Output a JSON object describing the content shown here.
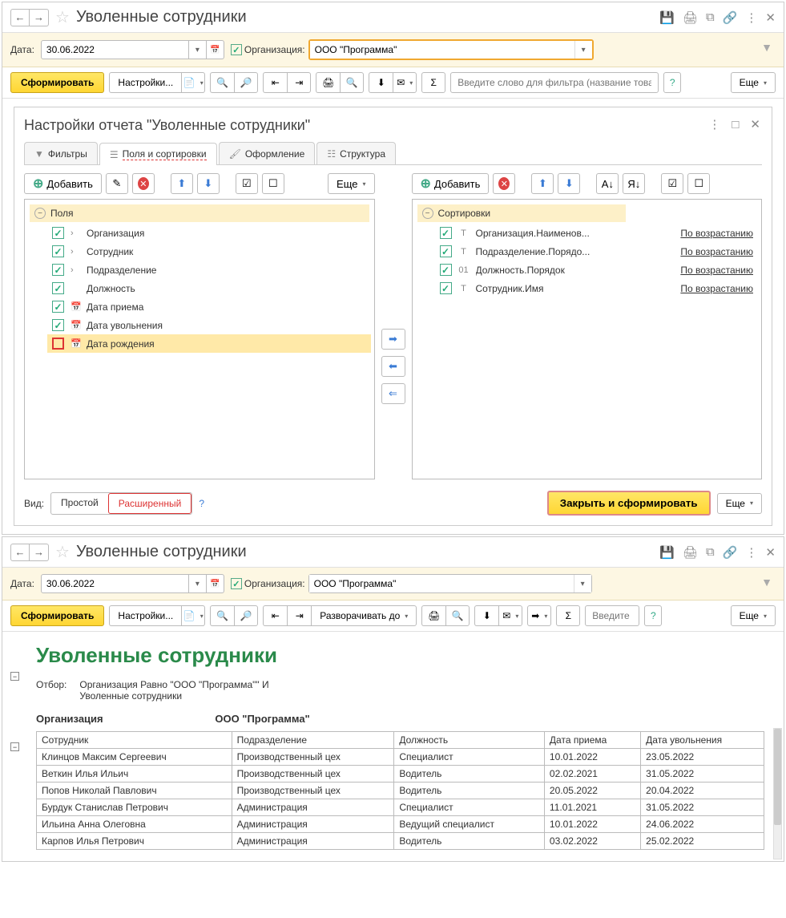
{
  "top": {
    "title": "Уволенные сотрудники",
    "date_label": "Дата:",
    "date_value": "30.06.2022",
    "org_label": "Организация:",
    "org_value": "ООО \"Программа\"",
    "form_btn": "Сформировать",
    "settings_btn": "Настройки...",
    "more_btn": "Еще",
    "search_placeholder": "Введите слово для фильтра (название товар..."
  },
  "settings": {
    "title": "Настройки отчета \"Уволенные сотрудники\"",
    "tab_filters": "Фильтры",
    "tab_fields": "Поля и сортировки",
    "tab_format": "Оформление",
    "tab_struct": "Структура",
    "add_btn": "Добавить",
    "more_btn": "Еще",
    "fields_header": "Поля",
    "sort_header": "Сортировки",
    "fields": [
      {
        "label": "Организация",
        "checked": true,
        "expand": true
      },
      {
        "label": "Сотрудник",
        "checked": true,
        "expand": true
      },
      {
        "label": "Подразделение",
        "checked": true,
        "expand": true
      },
      {
        "label": "Должность",
        "checked": true,
        "expand": false
      },
      {
        "label": "Дата приема",
        "checked": true,
        "expand": false,
        "icon": "date"
      },
      {
        "label": "Дата увольнения",
        "checked": true,
        "expand": false,
        "icon": "date"
      },
      {
        "label": "Дата рождения",
        "checked": false,
        "expand": false,
        "icon": "date",
        "selected": true
      }
    ],
    "sorts": [
      {
        "label": "Организация.Наименов...",
        "type": "T",
        "dir": "По возрастанию"
      },
      {
        "label": "Подразделение.Порядо...",
        "type": "T",
        "dir": "По возрастанию"
      },
      {
        "label": "Должность.Порядок",
        "type": "01",
        "dir": "По возрастанию"
      },
      {
        "label": "Сотрудник.Имя",
        "type": "T",
        "dir": "По возрастанию"
      }
    ],
    "view_label": "Вид:",
    "view_simple": "Простой",
    "view_ext": "Расширенный",
    "close_apply": "Закрыть и сформировать"
  },
  "bottom": {
    "title": "Уволенные сотрудники",
    "date_value": "30.06.2022",
    "org_value": "ООО \"Программа\"",
    "expand_btn": "Разворачивать до",
    "search_placeholder": "Введите сл...",
    "report_title": "Уволенные сотрудники",
    "filter_label": "Отбор:",
    "filter_text1": "Организация Равно \"ООО \"Программа\"\" И",
    "filter_text2": "Уволенные сотрудники",
    "org_header": "Организация",
    "org_value_bold": "ООО \"Программа\"",
    "cols": {
      "emp": "Сотрудник",
      "dept": "Подразделение",
      "pos": "Должность",
      "hire": "Дата приема",
      "fire": "Дата увольнения"
    },
    "rows": [
      {
        "emp": "Клинцов Максим Сергеевич",
        "dept": "Производственный цех",
        "pos": "Специалист",
        "hire": "10.01.2022",
        "fire": "23.05.2022"
      },
      {
        "emp": "Веткин Илья Ильич",
        "dept": "Производственный цех",
        "pos": "Водитель",
        "hire": "02.02.2021",
        "fire": "31.05.2022"
      },
      {
        "emp": "Попов Николай Павлович",
        "dept": "Производственный цех",
        "pos": "Водитель",
        "hire": "20.05.2022",
        "fire": "20.04.2022"
      },
      {
        "emp": "Бурдук Станислав Петрович",
        "dept": "Администрация",
        "pos": "Специалист",
        "hire": "11.01.2021",
        "fire": "31.05.2022"
      },
      {
        "emp": "Ильина Анна Олеговна",
        "dept": "Администрация",
        "pos": "Ведущий специалист",
        "hire": "10.01.2022",
        "fire": "24.06.2022"
      },
      {
        "emp": "Карпов Илья Петрович",
        "dept": "Администрация",
        "pos": "Водитель",
        "hire": "03.02.2022",
        "fire": "25.02.2022"
      }
    ]
  }
}
